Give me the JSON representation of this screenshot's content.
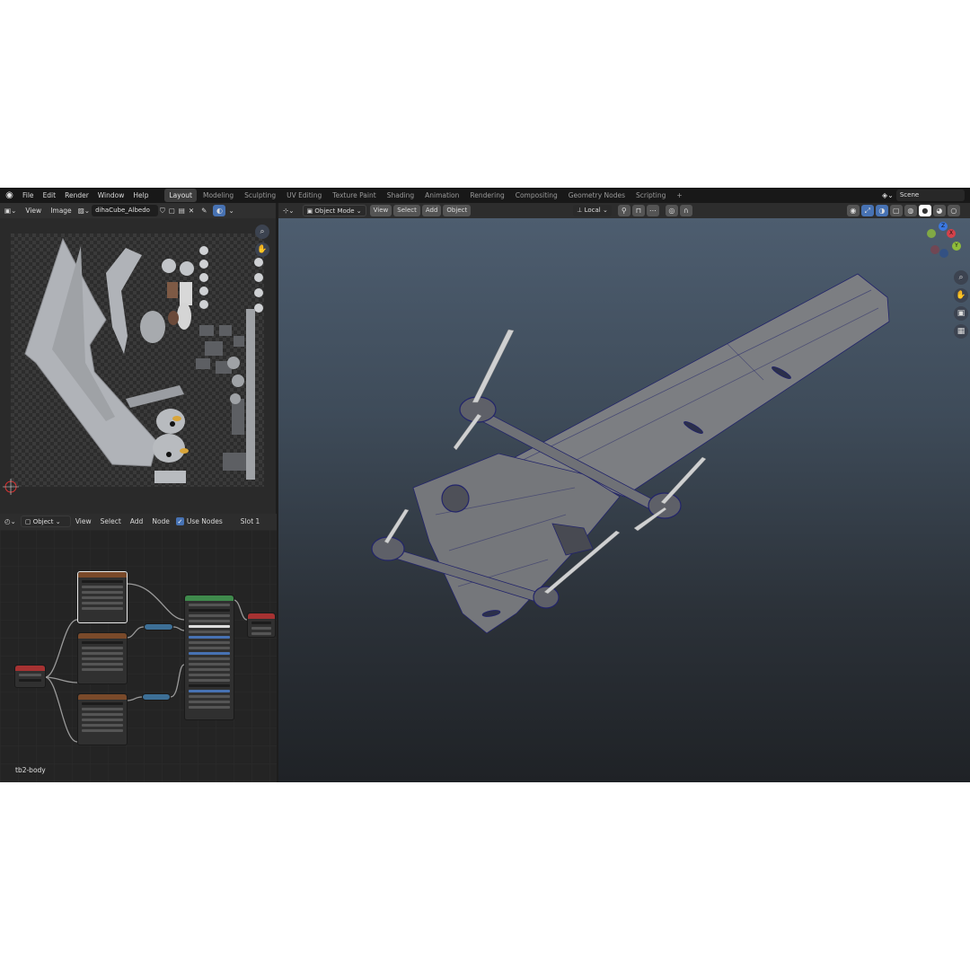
{
  "topbar": {
    "menu": [
      "File",
      "Edit",
      "Render",
      "Window",
      "Help"
    ],
    "workspaces": [
      "Layout",
      "Modeling",
      "Sculpting",
      "UV Editing",
      "Texture Paint",
      "Shading",
      "Animation",
      "Rendering",
      "Compositing",
      "Geometry Nodes",
      "Scripting"
    ],
    "active_workspace": "Layout",
    "add_tab": "+",
    "scene": "Scene"
  },
  "image_editor": {
    "menu": [
      "View",
      "Image"
    ],
    "image_name": "dihaCube_Albedo"
  },
  "node_editor": {
    "object_type": "Object",
    "menu": [
      "View",
      "Select",
      "Add",
      "Node"
    ],
    "use_nodes_label": "Use Nodes",
    "use_nodes_checked": true,
    "slot": "Slot 1",
    "material_name": "tb2-body"
  },
  "viewport": {
    "mode": "Object Mode",
    "menu": [
      "View",
      "Select",
      "Add",
      "Object"
    ],
    "transform_orientation": "Local",
    "gizmo_axes": [
      "X",
      "Y",
      "Z"
    ]
  },
  "colors": {
    "accent_blue": "#4772b3",
    "viewport_top": "#4d5d6f",
    "viewport_bottom": "#1f2226",
    "wire": "#22246a",
    "mesh_gray": "#7c7e82",
    "axis_x": "#d4414a",
    "axis_y": "#8fbd3b",
    "axis_z": "#3b78e0",
    "node_output_header": "#a63232",
    "node_image_header": "#7a4a2a",
    "node_shader_header": "#3f8a4c"
  }
}
